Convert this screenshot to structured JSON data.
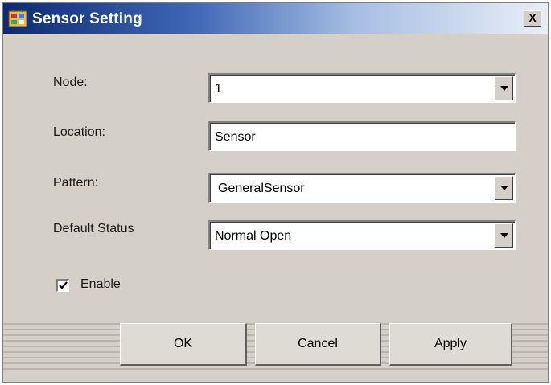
{
  "window": {
    "title": "Sensor Setting",
    "close_label": "X"
  },
  "form": {
    "node": {
      "label": "Node:",
      "value": "1"
    },
    "location": {
      "label": "Location:",
      "value": "Sensor"
    },
    "pattern": {
      "label": "Pattern:",
      "value": "GeneralSensor"
    },
    "default_status": {
      "label": "Default Status",
      "value": "Normal Open"
    },
    "enable": {
      "label": "Enable",
      "checked": true
    }
  },
  "buttons": {
    "ok": "OK",
    "cancel": "Cancel",
    "apply": "Apply"
  },
  "icons": {
    "app": "app-icon",
    "close": "close-icon",
    "dropdown": "chevron-down-icon",
    "check": "checkmark-icon"
  },
  "colors": {
    "titlebar_start": "#0c2a73",
    "titlebar_end": "#e9eef6",
    "dialog_bg": "#d4d0c8"
  }
}
